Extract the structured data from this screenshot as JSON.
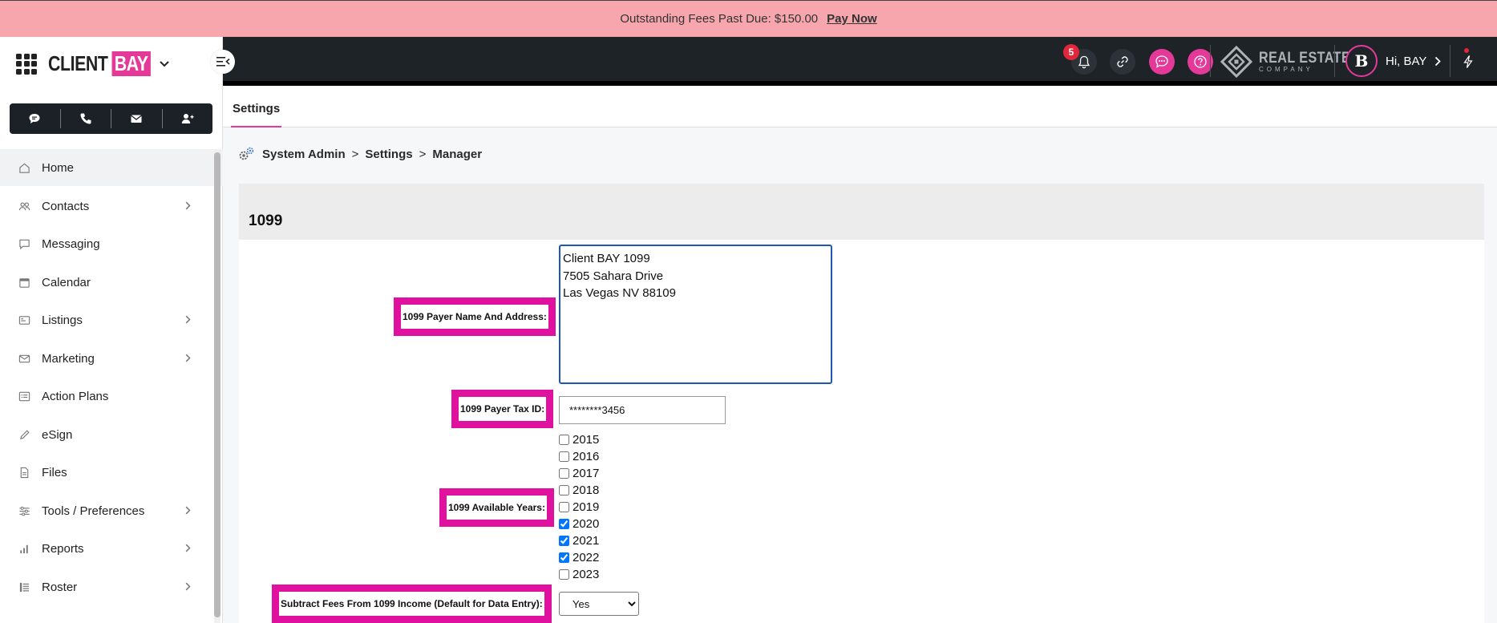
{
  "banner": {
    "message": "Outstanding Fees Past Due: $150.00",
    "action": "Pay Now"
  },
  "brand": {
    "name_part1": "CLIENT",
    "name_part2": "BAY"
  },
  "sidebar": {
    "items": [
      {
        "label": "Home",
        "icon": "home-icon",
        "has_submenu": false
      },
      {
        "label": "Contacts",
        "icon": "contacts-icon",
        "has_submenu": true
      },
      {
        "label": "Messaging",
        "icon": "chat-bubble-icon",
        "has_submenu": false
      },
      {
        "label": "Calendar",
        "icon": "calendar-icon",
        "has_submenu": false
      },
      {
        "label": "Listings",
        "icon": "listings-icon",
        "has_submenu": true
      },
      {
        "label": "Marketing",
        "icon": "mail-icon",
        "has_submenu": true
      },
      {
        "label": "Action Plans",
        "icon": "list-icon",
        "has_submenu": false
      },
      {
        "label": "eSign",
        "icon": "pen-icon",
        "has_submenu": false
      },
      {
        "label": "Files",
        "icon": "file-icon",
        "has_submenu": false
      },
      {
        "label": "Tools / Preferences",
        "icon": "sliders-icon",
        "has_submenu": true
      },
      {
        "label": "Reports",
        "icon": "bar-chart-icon",
        "has_submenu": true
      },
      {
        "label": "Roster",
        "icon": "roster-icon",
        "has_submenu": true
      }
    ]
  },
  "topbar": {
    "notification_count": "5",
    "company_line1": "REAL ESTATE",
    "company_line2": "COMPANY",
    "greeting": "Hi, BAY",
    "avatar_letter": "B"
  },
  "tabs": [
    {
      "label": "Settings"
    }
  ],
  "breadcrumb": {
    "items": [
      "System Admin",
      "Settings",
      "Manager"
    ],
    "separator": ">"
  },
  "panel": {
    "title": "1099",
    "fields": {
      "payer_name_label": "1099 Payer Name And Address:",
      "payer_name_value": "Client BAY 1099\n7505 Sahara Drive\nLas Vegas NV 88109",
      "tax_id_label": "1099 Payer Tax ID:",
      "tax_id_value": "********3456",
      "years_label": "1099 Available Years:",
      "years": [
        {
          "year": "2015",
          "checked": false
        },
        {
          "year": "2016",
          "checked": false
        },
        {
          "year": "2017",
          "checked": false
        },
        {
          "year": "2018",
          "checked": false
        },
        {
          "year": "2019",
          "checked": false
        },
        {
          "year": "2020",
          "checked": true
        },
        {
          "year": "2021",
          "checked": true
        },
        {
          "year": "2022",
          "checked": true
        },
        {
          "year": "2023",
          "checked": false
        }
      ],
      "subtract_fees_label": "Subtract Fees From 1099 Income (Default for Data Entry):",
      "subtract_fees_value": "Yes"
    }
  },
  "colors": {
    "accent": "#e5399a",
    "highlight": "#e1119f",
    "banner": "#f7a6ad",
    "topbar": "#1e2327"
  }
}
